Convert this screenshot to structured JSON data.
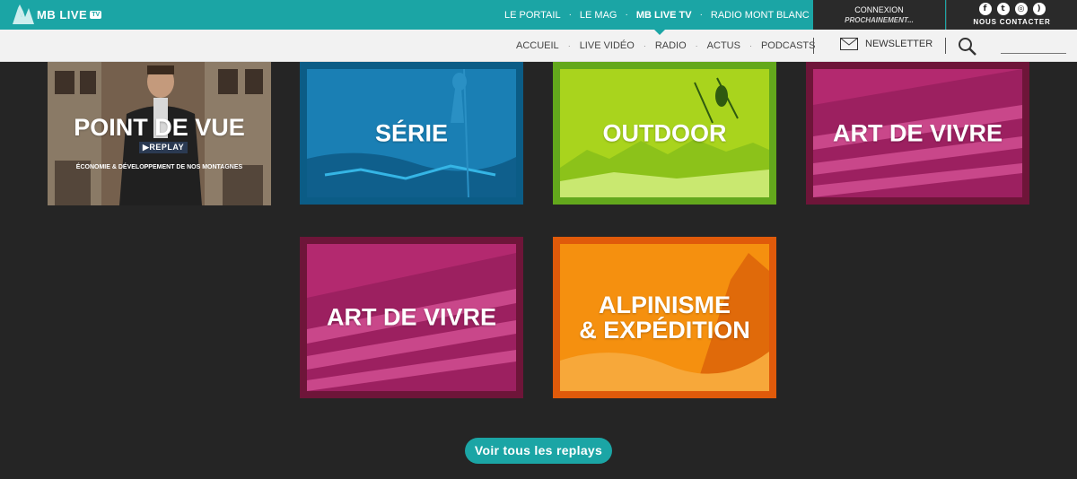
{
  "brand": {
    "name": "MB LIVE",
    "badge": "TV"
  },
  "top_nav": {
    "items": [
      {
        "label": "LE PORTAIL"
      },
      {
        "label": "LE MAG"
      },
      {
        "label": "MB LIVE TV"
      },
      {
        "label": "RADIO MONT BLANC"
      }
    ],
    "active": "MB LIVE TV"
  },
  "account": {
    "connect_label": "CONNEXION",
    "sub_label": "PROCHAINEMENT..."
  },
  "social": {
    "icons": [
      "facebook-icon",
      "twitter-icon",
      "instagram-icon",
      "rss-icon"
    ],
    "contact_label": "NOUS CONTACTER"
  },
  "sub_nav": {
    "items": [
      {
        "label": "ACCUEIL"
      },
      {
        "label": "LIVE VIDÉO"
      },
      {
        "label": "RADIO"
      },
      {
        "label": "ACTUS"
      },
      {
        "label": "PODCASTS"
      }
    ],
    "newsletter_label": "NEWSLETTER",
    "search_placeholder": ""
  },
  "tiles": [
    {
      "title": "POINT DE VUE",
      "badge": "REPLAY",
      "subtitle": "ÉCONOMIE & DÉVELOPPEMENT DE NOS MONTAGNES"
    },
    {
      "title": "SÉRIE"
    },
    {
      "title": "OUTDOOR"
    },
    {
      "title": "ART DE VIVRE"
    },
    {
      "title": "ART DE VIVRE"
    },
    {
      "title_line1": "ALPINISME",
      "title_line2": "& EXPÉDITION"
    }
  ],
  "replays_button": {
    "label": "Voir tous les replays"
  },
  "colors": {
    "accent": "#1ba5a5",
    "background": "#252525",
    "serie": "#0b5c86",
    "outdoor": "#63a81c",
    "art_de_vivre": "#6e1539",
    "alpinisme": "#e05a0a"
  }
}
